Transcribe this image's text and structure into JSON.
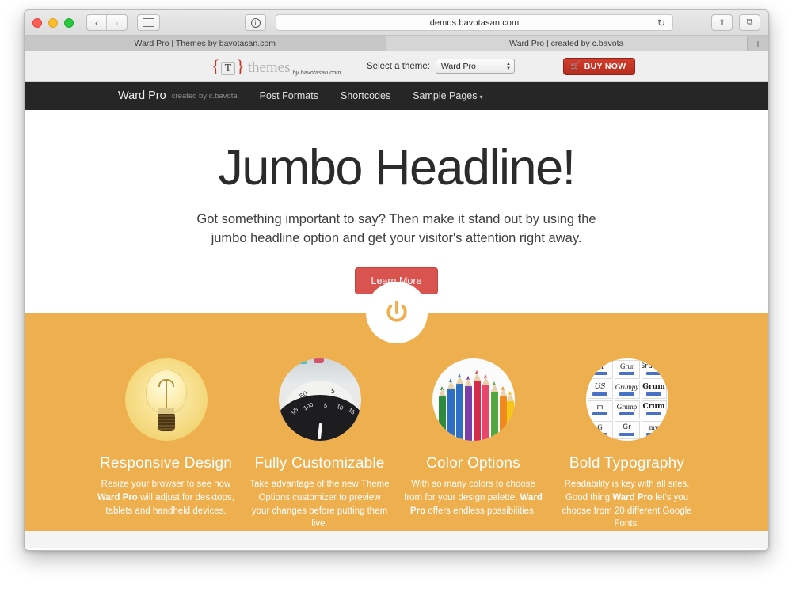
{
  "browser": {
    "traffic_lights": [
      "close",
      "minimize",
      "zoom"
    ],
    "back_label": "‹",
    "forward_label": "›",
    "sidebar_icon": "sidebar-icon",
    "info_glyph": "i",
    "url": "demos.bavotasan.com",
    "reload_glyph": "↻",
    "share_glyph": "⇧",
    "tabs_glyph": "⧉",
    "tabs": [
      {
        "title": "Ward Pro | Themes by bavotasan.com",
        "active": false
      },
      {
        "title": "Ward Pro | created by c.bavota",
        "active": true
      }
    ],
    "new_tab_label": "+"
  },
  "demo_bar": {
    "logo": {
      "left_brace": "{",
      "letter": "T",
      "right_brace": "}",
      "word": "themes",
      "subtitle": "by bavotasan.com"
    },
    "select_label": "Select a theme:",
    "selected_theme": "Ward Pro",
    "theme_options": [
      "Ward Pro"
    ],
    "buy_now_label": "BUY NOW",
    "cart_icon": "shopping-cart-icon"
  },
  "site_nav": {
    "brand": "Ward Pro",
    "brand_sub": "created by c.bavota",
    "links": [
      {
        "label": "Post Formats",
        "has_caret": false
      },
      {
        "label": "Shortcodes",
        "has_caret": false
      },
      {
        "label": "Sample Pages",
        "has_caret": true
      }
    ],
    "caret": "▾"
  },
  "hero": {
    "headline": "Jumbo Headline!",
    "subtext": "Got something important to say? Then make it stand out by using the jumbo headline option and get your visitor's attention right away.",
    "button_label": "Learn More",
    "button_color": "#d9534f"
  },
  "features": {
    "band_color": "#eeaf4e",
    "power_icon": "power-icon",
    "columns": [
      {
        "image": "lightbulb-image",
        "title": "Responsive Design",
        "body_parts": [
          {
            "text": "Resize your browser to see how ",
            "bold": false
          },
          {
            "text": "Ward Pro",
            "bold": true
          },
          {
            "text": " will adjust for desktops, tablets and handheld devices.",
            "bold": false
          }
        ]
      },
      {
        "image": "dial-gauge-image",
        "title": "Fully Customizable",
        "body_parts": [
          {
            "text": "Take advantage of the new Theme Options customizer to preview your changes before putting them live.",
            "bold": false
          }
        ]
      },
      {
        "image": "colored-pencils-image",
        "title": "Color Options",
        "body_parts": [
          {
            "text": "With so many colors to choose from for your design palette, ",
            "bold": false
          },
          {
            "text": "Ward Pro",
            "bold": true
          },
          {
            "text": " offers endless possibilities.",
            "bold": false
          }
        ]
      },
      {
        "image": "google-fonts-grid-image",
        "title": "Bold Typography",
        "body_parts": [
          {
            "text": "Readability is key with all sites. Good thing ",
            "bold": false
          },
          {
            "text": "Ward Pro",
            "bold": true
          },
          {
            "text": " let's you choose from 20 different Google Fonts.",
            "bold": false
          }
        ]
      }
    ],
    "dial_numbers": [
      "5",
      "60",
      "5",
      "95",
      "100",
      "5",
      "10",
      "15"
    ],
    "pencil_colors": [
      "#2e8b3e",
      "#2f6fc4",
      "#7b3fa8",
      "#d62b4a",
      "#e8456b",
      "#52a83f",
      "#f08a1e",
      "#f5c518"
    ],
    "font_specimens": [
      "MF",
      "Grur",
      "Grumpy",
      "US",
      "Grumpy",
      "Grum",
      "m",
      "Grump",
      "Crum",
      "G"
    ]
  }
}
